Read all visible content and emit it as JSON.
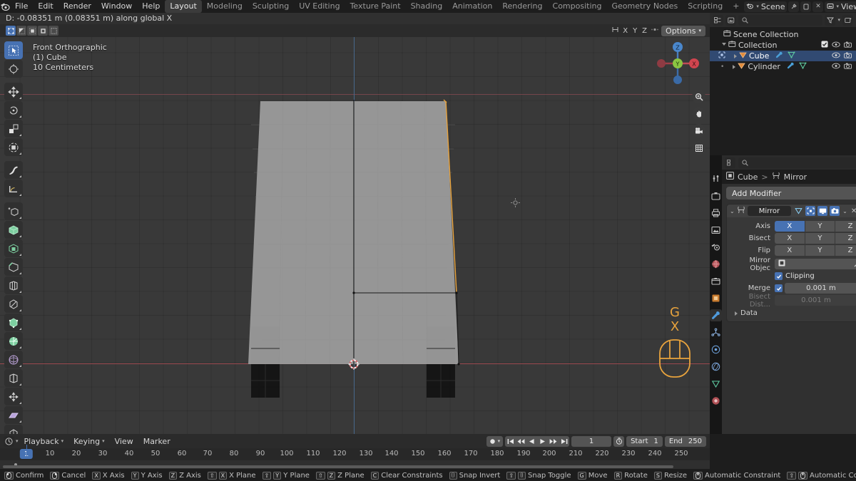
{
  "app": {
    "menus": [
      "File",
      "Edit",
      "Render",
      "Window",
      "Help"
    ],
    "workspaces": [
      {
        "label": "Layout",
        "active": true
      },
      {
        "label": "Modeling",
        "active": false
      },
      {
        "label": "Sculpting",
        "active": false
      },
      {
        "label": "UV Editing",
        "active": false
      },
      {
        "label": "Texture Paint",
        "active": false
      },
      {
        "label": "Shading",
        "active": false
      },
      {
        "label": "Animation",
        "active": false
      },
      {
        "label": "Rendering",
        "active": false
      },
      {
        "label": "Compositing",
        "active": false
      },
      {
        "label": "Geometry Nodes",
        "active": false
      },
      {
        "label": "Scripting",
        "active": false
      },
      {
        "label": "+",
        "active": false
      }
    ],
    "scene_name": "Scene",
    "viewlayer_name": "ViewLayer"
  },
  "operator_header": {
    "text": "D: -0.08351 m (0.08351 m) along global X"
  },
  "viewport": {
    "view_name": "Front Orthographic",
    "collection_object": "(1) Cube",
    "grid_scale": "10 Centimeters",
    "header": {
      "axis_letters": [
        "X",
        "Y",
        "Z"
      ],
      "options_label": "Options"
    },
    "gizmo": {
      "x_label": "X",
      "y_label": "Y",
      "z_label": "Z"
    },
    "key_hints": [
      "G",
      "X"
    ],
    "tools": [
      {
        "name": "tweak",
        "active": true
      },
      {
        "name": "cursor",
        "active": false
      },
      {
        "name": "move",
        "active": false
      },
      {
        "name": "rotate",
        "active": false
      },
      {
        "name": "scale",
        "active": false
      },
      {
        "name": "transform",
        "active": false
      },
      {
        "name": "annotate",
        "active": false
      },
      {
        "name": "measure",
        "active": false
      },
      {
        "name": "add-cube",
        "active": false
      },
      {
        "name": "extrude-region",
        "active": false
      },
      {
        "name": "inset-faces",
        "active": false
      },
      {
        "name": "bevel",
        "active": false
      },
      {
        "name": "loop-cut",
        "active": false
      },
      {
        "name": "knife",
        "active": false
      },
      {
        "name": "poly-build",
        "active": false
      },
      {
        "name": "spin",
        "active": false
      },
      {
        "name": "smooth",
        "active": false
      },
      {
        "name": "edge-slide",
        "active": false
      },
      {
        "name": "shrink-fatten",
        "active": false
      },
      {
        "name": "shear",
        "active": false
      },
      {
        "name": "rip-region",
        "active": false
      }
    ]
  },
  "outliner": {
    "search_placeholder": "",
    "items": [
      {
        "label": "Scene Collection",
        "depth": 0,
        "icon": "collection-icon",
        "selected": false,
        "has_toggles": false
      },
      {
        "label": "Collection",
        "depth": 1,
        "icon": "collection-icon",
        "selected": false,
        "has_toggles": true
      },
      {
        "label": "Cube",
        "depth": 2,
        "icon": "mesh-icon",
        "selected": true,
        "has_toggles": true
      },
      {
        "label": "Cylinder",
        "depth": 2,
        "icon": "mesh-icon",
        "selected": false,
        "has_toggles": true
      }
    ]
  },
  "properties": {
    "breadcrumb": {
      "object": "Cube",
      "separator": ">",
      "modifier": "Mirror"
    },
    "add_modifier_label": "Add Modifier",
    "tabs": [
      {
        "name": "tool-tab",
        "active": false
      },
      {
        "name": "render-tab",
        "active": false
      },
      {
        "name": "output-tab",
        "active": false
      },
      {
        "name": "view-layer-tab",
        "active": false
      },
      {
        "name": "scene-tab",
        "active": false
      },
      {
        "name": "world-tab",
        "active": false
      },
      {
        "name": "collection-tab",
        "active": false
      },
      {
        "name": "object-tab",
        "active": false
      },
      {
        "name": "modifier-tab",
        "active": true
      },
      {
        "name": "particles-tab",
        "active": false
      },
      {
        "name": "physics-tab",
        "active": false
      },
      {
        "name": "constraints-tab",
        "active": false
      },
      {
        "name": "data-tab",
        "active": false
      },
      {
        "name": "material-tab",
        "active": false
      }
    ],
    "modifier": {
      "name": "Mirror",
      "display_toggles": [
        {
          "name": "on-cage",
          "on": false
        },
        {
          "name": "edit-mode",
          "on": true
        },
        {
          "name": "realtime",
          "on": true
        },
        {
          "name": "render",
          "on": true
        }
      ],
      "rows": [
        {
          "label": "Axis",
          "buttons": [
            "X",
            "Y",
            "Z"
          ],
          "on": [
            true,
            false,
            false
          ]
        },
        {
          "label": "Bisect",
          "buttons": [
            "X",
            "Y",
            "Z"
          ],
          "on": [
            false,
            false,
            false
          ]
        },
        {
          "label": "Flip",
          "buttons": [
            "X",
            "Y",
            "Z"
          ],
          "on": [
            false,
            false,
            false
          ]
        }
      ],
      "mirror_object_label": "Mirror Objec",
      "mirror_object_value": "",
      "clipping_label": "Clipping",
      "clipping_checked": true,
      "merge_label": "Merge",
      "merge_checked": true,
      "merge_value": "0.001 m",
      "bisect_distance_label": "Bisect Dist...",
      "bisect_distance_value": "0.001 m",
      "data_panel_label": "Data"
    }
  },
  "timeline": {
    "menus": [
      "Playback",
      "Keying",
      "View",
      "Marker"
    ],
    "current_frame": "1",
    "start_label": "Start",
    "start_value": "1",
    "end_label": "End",
    "end_value": "250",
    "ticks": [
      "1",
      "10",
      "20",
      "30",
      "40",
      "50",
      "60",
      "70",
      "80",
      "90",
      "100",
      "110",
      "120",
      "130",
      "140",
      "150",
      "160",
      "170",
      "180",
      "190",
      "200",
      "210",
      "220",
      "230",
      "240",
      "250"
    ],
    "playhead_label": "1"
  },
  "statusbar": {
    "items": [
      {
        "keys": [
          "mouse-left"
        ],
        "label": "Confirm"
      },
      {
        "keys": [
          "mouse-right"
        ],
        "label": "Cancel"
      },
      {
        "keys": [
          "X"
        ],
        "label": "X Axis"
      },
      {
        "keys": [
          "Y"
        ],
        "label": "Y Axis"
      },
      {
        "keys": [
          "Z"
        ],
        "label": "Z Axis"
      },
      {
        "keys": [
          "⇧",
          "X"
        ],
        "label": "X Plane"
      },
      {
        "keys": [
          "⇧",
          "Y"
        ],
        "label": "Y Plane"
      },
      {
        "keys": [
          "⇧",
          "Z"
        ],
        "label": "Z Plane"
      },
      {
        "keys": [
          "C"
        ],
        "label": "Clear Constraints"
      },
      {
        "keys": [
          "⌷"
        ],
        "label": "Snap Invert"
      },
      {
        "keys": [
          "⇧",
          "⌷"
        ],
        "label": "Snap Toggle"
      },
      {
        "keys": [
          "G"
        ],
        "label": "Move"
      },
      {
        "keys": [
          "R"
        ],
        "label": "Rotate"
      },
      {
        "keys": [
          "S"
        ],
        "label": "Resize"
      },
      {
        "keys": [
          "mouse-mid"
        ],
        "label": "Automatic Constraint"
      },
      {
        "keys": [
          "⇧",
          "mouse-mid"
        ],
        "label": "Automatic Constraint Plane"
      }
    ]
  },
  "colors": {
    "accent_blue": "#4772b3",
    "orange_highlight": "#e8a33d",
    "viewport_bg": "#393939",
    "panel_bg": "#303030",
    "editor_bg": "#1d1d1d",
    "header_bg": "#2b2b2b",
    "axis_x_red": "#9e4c52",
    "axis_z_blue": "#4b6a8e",
    "mesh_gray": "#9d9d9d"
  }
}
